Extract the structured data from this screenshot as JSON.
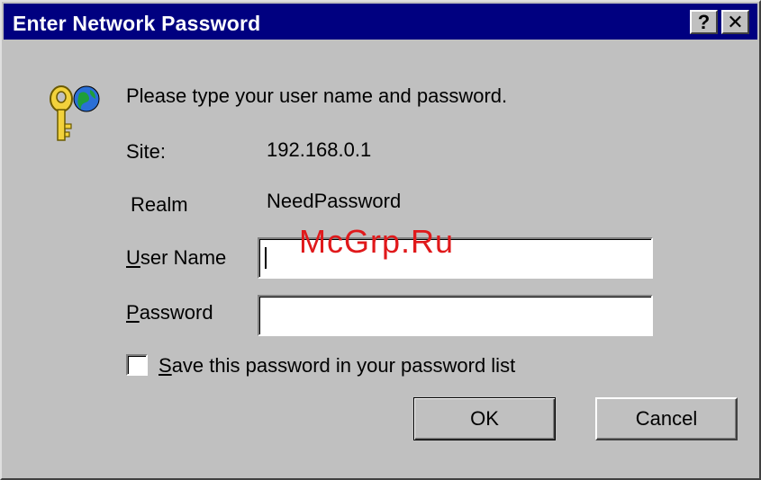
{
  "window": {
    "title": "Enter Network Password",
    "help_label": "?",
    "close_label": "✕"
  },
  "dialog": {
    "icon": "key-globe-icon",
    "prompt": "Please type your user name and password.",
    "site_label": "Site:",
    "site_value": "192.168.0.1",
    "realm_label": "Realm",
    "realm_value": "NeedPassword",
    "user_name_label_accel": "U",
    "user_name_label_rest": "ser Name",
    "user_name_value": "",
    "password_label_accel": "P",
    "password_label_rest": "assword",
    "password_value": "",
    "save_label_accel": "S",
    "save_label_rest": "ave this password in your password list",
    "save_checked": false
  },
  "buttons": {
    "ok_label": "OK",
    "cancel_label": "Cancel"
  },
  "watermark": {
    "text": "McGrp.Ru",
    "color": "#e0191b"
  },
  "colors": {
    "titlebar": "#000080",
    "face": "#c0c0c0"
  }
}
